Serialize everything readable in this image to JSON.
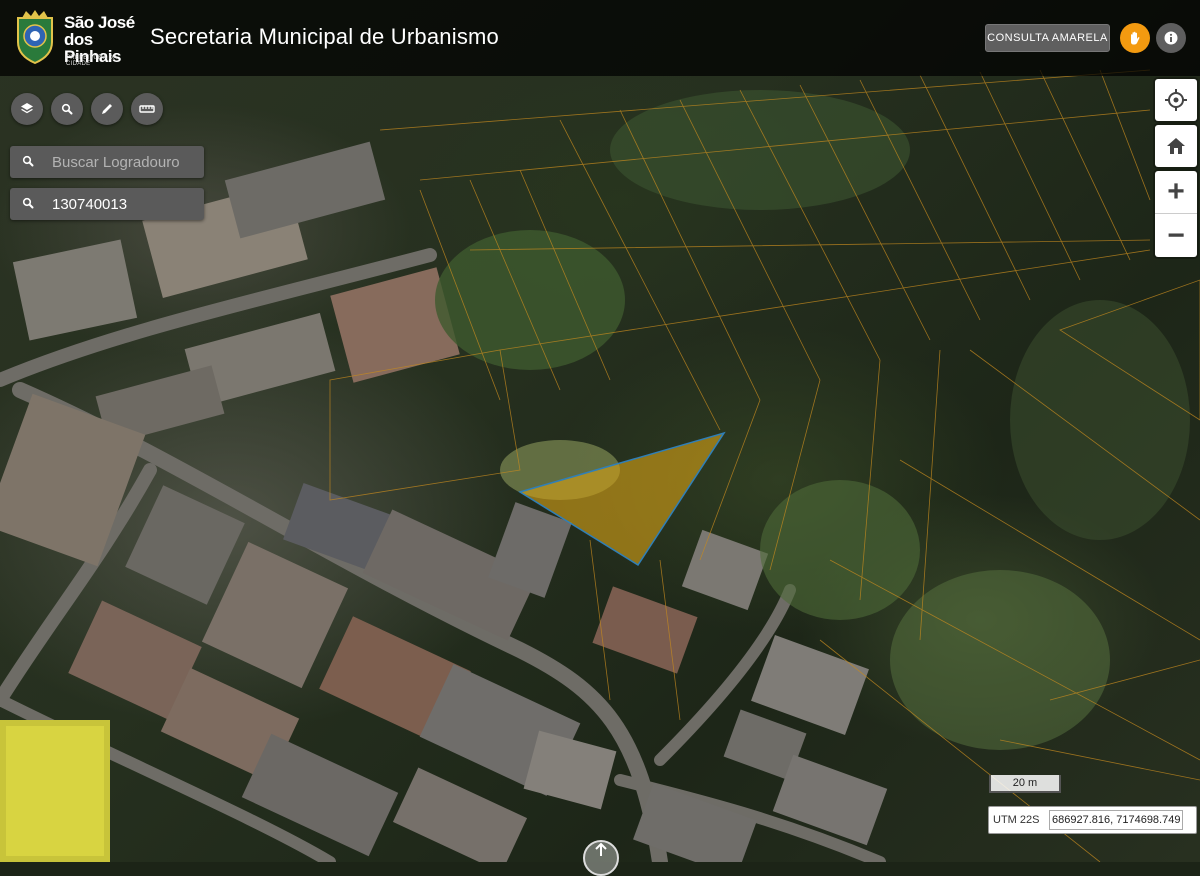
{
  "header": {
    "logo": {
      "city_line1": "São José",
      "city_line2": "dos Pinhais",
      "subtitle": "PREFEITURA DA CIDADE"
    },
    "title": "Secretaria Municipal de Urbanismo",
    "consulta_label": "CONSULTA AMARELA",
    "hand_icon": "hand-icon",
    "info_icon": "info-icon"
  },
  "tools": [
    {
      "name": "layers-icon"
    },
    {
      "name": "search-icon"
    },
    {
      "name": "pencil-icon"
    },
    {
      "name": "ruler-icon"
    }
  ],
  "search": {
    "street_placeholder": "Buscar Logradouro",
    "street_value": "",
    "code_value": "130740013"
  },
  "controls": {
    "zoom_in": "+",
    "zoom_out": "−"
  },
  "scale": {
    "label": "20 m"
  },
  "coords": {
    "projection": "UTM 22S",
    "value": "686927.816, 7174698.749"
  },
  "colors": {
    "accent": "#f39a10",
    "parcel_line": "#c58a1f",
    "selected_fill": "#d4a017",
    "selected_stroke": "#2f7fb8"
  }
}
